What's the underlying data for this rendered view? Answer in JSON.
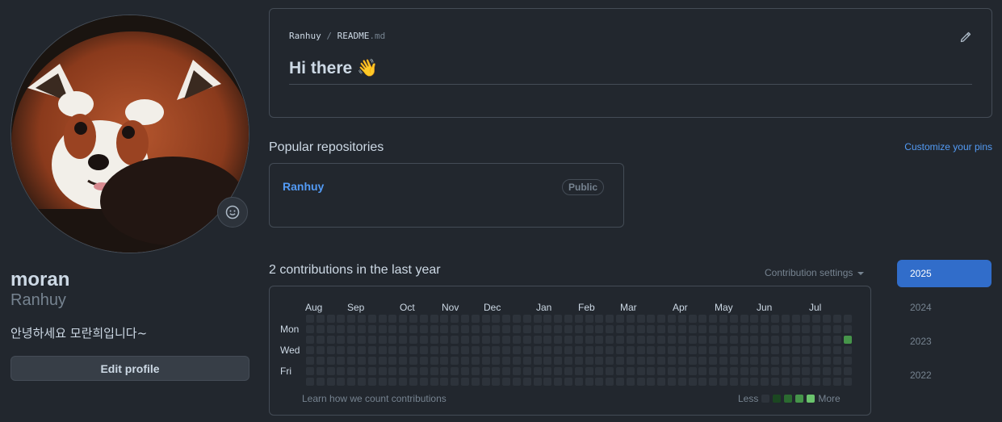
{
  "profile": {
    "name": "moran",
    "login": "Ranhuy",
    "bio": "안녕하세요 모란희입니다~",
    "edit_label": "Edit profile",
    "avatar_icon": "red-panda-avatar",
    "status_icon": "smiley-icon"
  },
  "readme": {
    "owner": "Ranhuy",
    "separator": "/",
    "file": "README",
    "ext": ".md",
    "heading": "Hi there 👋",
    "edit_icon": "pencil-icon"
  },
  "popular": {
    "title": "Popular repositories",
    "customize_label": "Customize your pins",
    "repos": [
      {
        "name": "Ranhuy",
        "visibility": "Public"
      }
    ]
  },
  "contributions": {
    "title": "2 contributions in the last year",
    "settings_label": "Contribution settings",
    "months": [
      "Aug",
      "Sep",
      "Oct",
      "Nov",
      "Dec",
      "Jan",
      "Feb",
      "Mar",
      "Apr",
      "May",
      "Jun",
      "Jul"
    ],
    "days": [
      "Mon",
      "Wed",
      "Fri"
    ],
    "weeks": 53,
    "active_cell": {
      "week": 52,
      "day": 2,
      "level": 3
    },
    "learn_label": "Learn how we count contributions",
    "legend_less": "Less",
    "legend_more": "More",
    "level_colors": [
      "#2d333b",
      "#1b4721",
      "#2b6a30",
      "#46954a",
      "#6bc46d"
    ]
  },
  "years": [
    "2025",
    "2024",
    "2023",
    "2022"
  ],
  "selected_year": "2025",
  "colors": {
    "background": "#22272e",
    "border": "#444c56",
    "link": "#539bf5",
    "accent": "#316dca"
  }
}
